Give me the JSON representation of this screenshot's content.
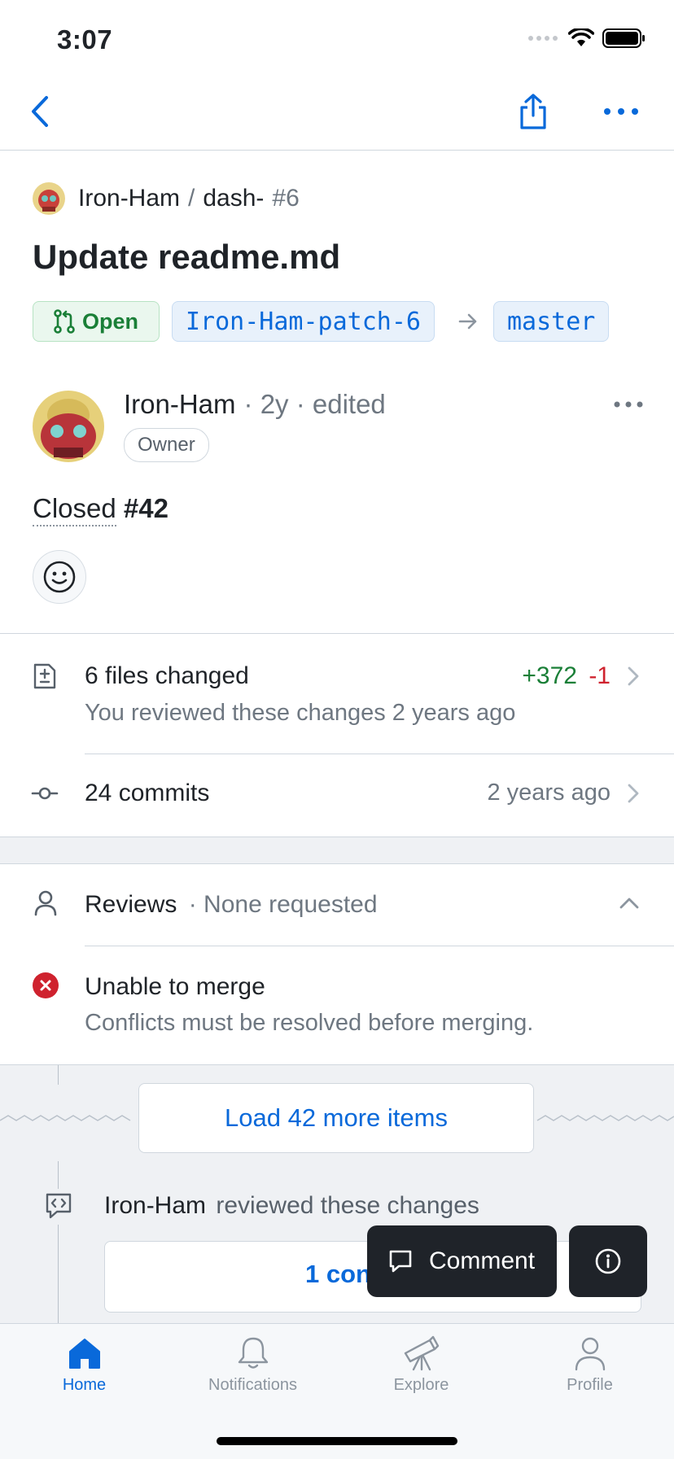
{
  "status_bar": {
    "time": "3:07"
  },
  "nav": {
    "back": "back",
    "share": "share",
    "more": "more"
  },
  "repo": {
    "owner": "Iron-Ham",
    "separator": "/",
    "name": "dash-",
    "number": "#6"
  },
  "pr": {
    "title": "Update readme.md",
    "state": "Open",
    "head_branch": "Iron-Ham-patch-6",
    "base_branch": "master"
  },
  "author": {
    "name": "Iron-Ham",
    "meta": "· 2y · edited",
    "badge": "Owner",
    "body_prefix": "Closed",
    "body_ref": "#42"
  },
  "files": {
    "title": "6 files changed",
    "subtitle": "You reviewed these changes 2 years ago",
    "additions": "+372",
    "deletions": "-1"
  },
  "commits": {
    "title": "24 commits",
    "time": "2 years ago"
  },
  "reviews": {
    "title": "Reviews",
    "status": "· None requested"
  },
  "merge": {
    "title": "Unable to merge",
    "subtitle": "Conflicts must be resolved before merging."
  },
  "timeline": {
    "load_more": "Load 42 more items",
    "review_actor": "Iron-Ham",
    "review_text": "reviewed these changes",
    "comment_card": "1 con"
  },
  "floating": {
    "comment": "Comment"
  },
  "tabs": [
    {
      "label": "Home"
    },
    {
      "label": "Notifications"
    },
    {
      "label": "Explore"
    },
    {
      "label": "Profile"
    }
  ],
  "colors": {
    "accent": "#0969da",
    "open_green": "#1a7f37",
    "additions": "#1a7f37",
    "deletions": "#cf222e",
    "error": "#cf222e"
  }
}
